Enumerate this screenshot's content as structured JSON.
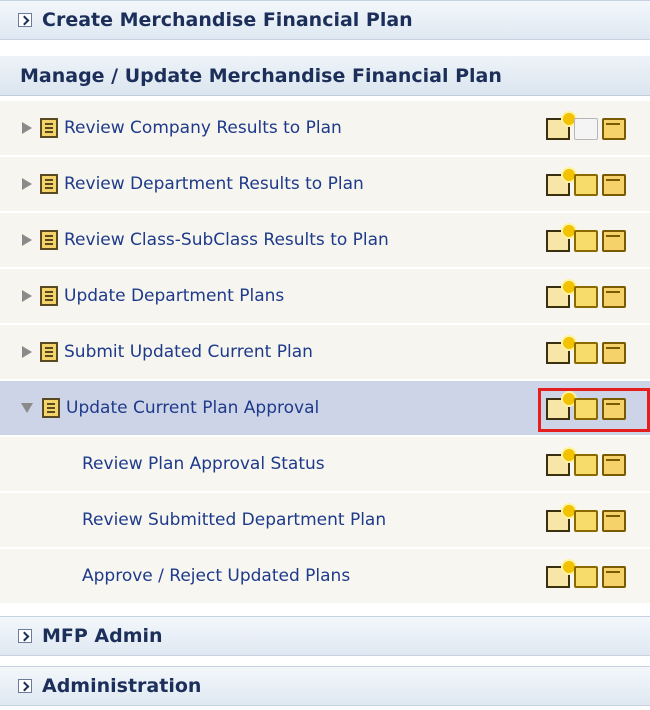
{
  "panel": {
    "create_header": "Create Merchandise Financial Plan",
    "manage_title": "Manage / Update Merchandise Financial Plan",
    "rows": [
      {
        "label": "Review Company Results to Plan",
        "state": "collapsed",
        "open_disabled": true
      },
      {
        "label": "Review Department Results to Plan",
        "state": "collapsed",
        "open_disabled": false
      },
      {
        "label": "Review Class-SubClass Results to Plan",
        "state": "collapsed",
        "open_disabled": false
      },
      {
        "label": "Update Department Plans",
        "state": "collapsed",
        "open_disabled": false
      },
      {
        "label": "Submit Updated Current Plan",
        "state": "collapsed",
        "open_disabled": false
      },
      {
        "label": "Update Current Plan Approval",
        "state": "expanded",
        "selected": true,
        "open_disabled": false
      }
    ],
    "children": [
      {
        "label": "Review Plan Approval Status"
      },
      {
        "label": "Review Submitted Department Plan"
      },
      {
        "label": "Approve / Reject Updated Plans"
      }
    ],
    "mfp_admin_header": "MFP Admin",
    "administration_header": "Administration"
  },
  "icons": {
    "new": "new-document-icon",
    "open": "open-icon",
    "open_all": "open-folder-icon",
    "expand": "triangle-right-icon",
    "collapse": "triangle-down-icon",
    "task": "task-document-icon"
  },
  "colors": {
    "highlight_border": "#e51d1d",
    "selected_row": "#cdd4e7",
    "link_text": "#1e3a8a"
  }
}
